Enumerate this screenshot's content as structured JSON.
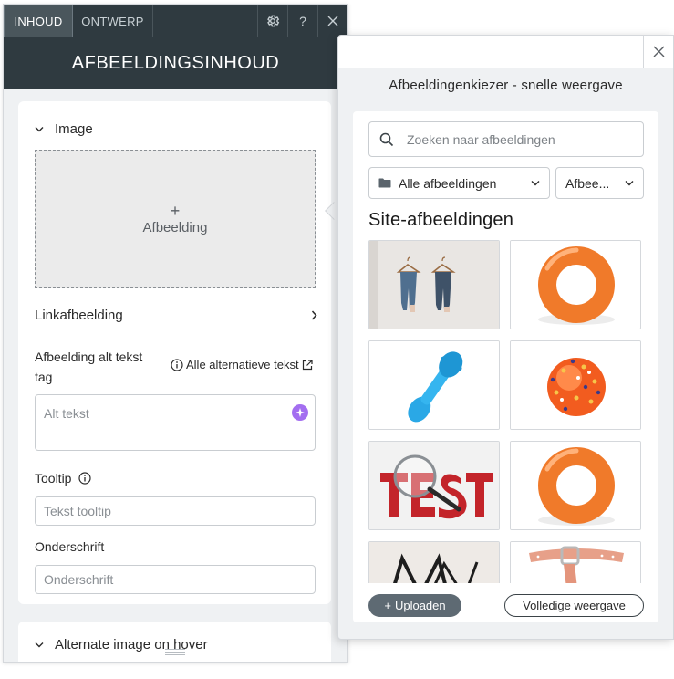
{
  "tabs": {
    "content": "INHOUD",
    "design": "ONTWERP"
  },
  "panel": {
    "title": "AFBEELDINGSINHOUD",
    "section_image": "Image",
    "drop_plus": "+",
    "drop_label": "Afbeelding",
    "link_label": "Linkafbeelding",
    "alt_label": "Afbeelding alt tekst tag",
    "alt_all_link": "Alle alternatieve tekst",
    "alt_placeholder": "Alt tekst",
    "tooltip_label": "Tooltip",
    "tooltip_placeholder": "Tekst tooltip",
    "caption_label": "Onderschrift",
    "caption_placeholder": "Onderschrift",
    "section_hover": "Alternate image on hover"
  },
  "picker": {
    "title": "Afbeeldingenkiezer - snelle weergave",
    "search_placeholder": "Zoeken naar afbeeldingen",
    "folder_select": "Alle afbeeldingen",
    "type_select": "Afbee...",
    "section_title": "Site-afbeeldingen",
    "images": [
      {
        "name": "jeans-on-hangers"
      },
      {
        "name": "orange-ring-toy"
      },
      {
        "name": "blue-dog-toy"
      },
      {
        "name": "orange-spiky-ball"
      },
      {
        "name": "test-magnifier"
      },
      {
        "name": "orange-ring-toy"
      },
      {
        "name": "monogram-mn"
      },
      {
        "name": "pink-collar"
      }
    ],
    "upload_label": "Uploaden",
    "upload_plus": "+",
    "full_view_label": "Volledige weergave"
  },
  "colors": {
    "header_dark": "#2f3a40",
    "ai_purple": "#a36ef0",
    "toy_orange": "#f07a2a",
    "toy_blue": "#2aa8e6"
  }
}
